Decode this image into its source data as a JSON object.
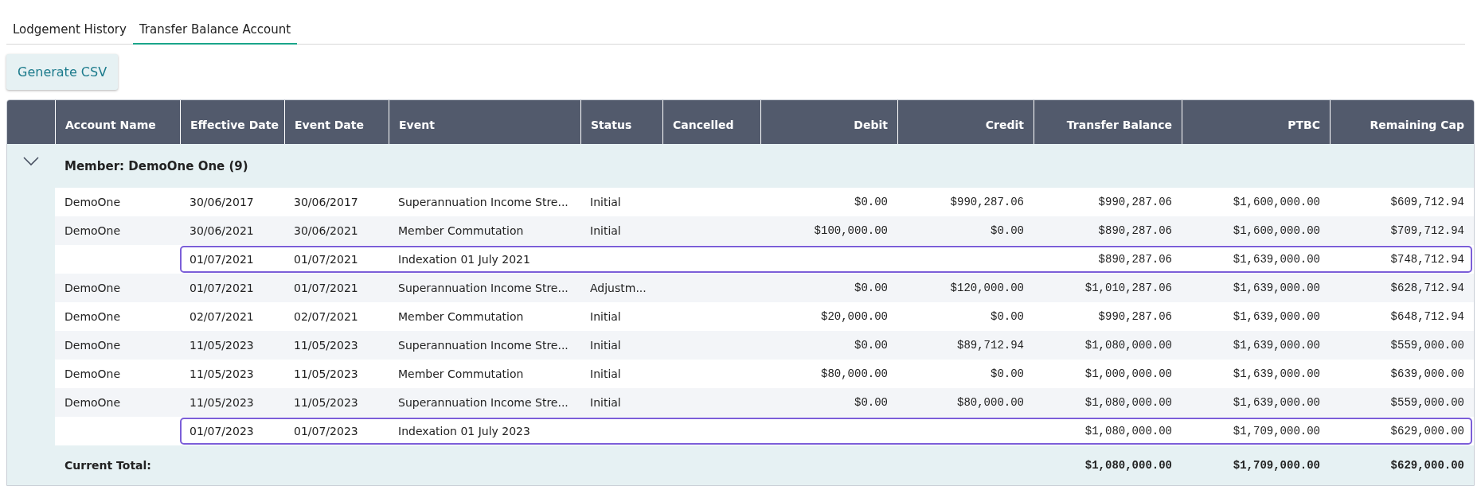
{
  "tabs": [
    {
      "label": "Lodgement History",
      "selected": false
    },
    {
      "label": "Transfer Balance Account",
      "selected": true
    }
  ],
  "toolbar": {
    "button": "Generate CSV"
  },
  "table": {
    "columns": [
      {
        "label": "Account Name",
        "kind": "text"
      },
      {
        "label": "Effective Date",
        "kind": "text"
      },
      {
        "label": "Event Date",
        "kind": "text"
      },
      {
        "label": "Event",
        "kind": "text"
      },
      {
        "label": "Status",
        "kind": "text"
      },
      {
        "label": "Cancelled",
        "kind": "text"
      },
      {
        "label": "Debit",
        "kind": "money"
      },
      {
        "label": "Credit",
        "kind": "money"
      },
      {
        "label": "Transfer Balance",
        "kind": "money"
      },
      {
        "label": "PTBC",
        "kind": "money"
      },
      {
        "label": "Remaining Cap",
        "kind": "money"
      }
    ],
    "groups": [
      {
        "label": "Member: DemoOne One (9)",
        "expanded": true,
        "rows": [
          {
            "highlighted": false,
            "cells": [
              "DemoOne",
              "30/06/2017",
              "30/06/2017",
              "Superannuation Income Stre...",
              "Initial",
              null,
              "$0.00",
              "$990,287.06",
              "$990,287.06",
              "$1,600,000.00",
              "$609,712.94"
            ]
          },
          {
            "highlighted": false,
            "cells": [
              "DemoOne",
              "30/06/2021",
              "30/06/2021",
              "Member Commutation",
              "Initial",
              null,
              "$100,000.00",
              "$0.00",
              "$890,287.06",
              "$1,600,000.00",
              "$709,712.94"
            ]
          },
          {
            "highlighted": true,
            "cells": [
              null,
              "01/07/2021",
              "01/07/2021",
              "Indexation 01 July 2021",
              null,
              null,
              null,
              null,
              "$890,287.06",
              "$1,639,000.00",
              "$748,712.94"
            ]
          },
          {
            "highlighted": false,
            "cells": [
              "DemoOne",
              "01/07/2021",
              "01/07/2021",
              "Superannuation Income Stre...",
              "Adjustm...",
              null,
              "$0.00",
              "$120,000.00",
              "$1,010,287.06",
              "$1,639,000.00",
              "$628,712.94"
            ]
          },
          {
            "highlighted": false,
            "cells": [
              "DemoOne",
              "02/07/2021",
              "02/07/2021",
              "Member Commutation",
              "Initial",
              null,
              "$20,000.00",
              "$0.00",
              "$990,287.06",
              "$1,639,000.00",
              "$648,712.94"
            ]
          },
          {
            "highlighted": false,
            "cells": [
              "DemoOne",
              "11/05/2023",
              "11/05/2023",
              "Superannuation Income Stre...",
              "Initial",
              null,
              "$0.00",
              "$89,712.94",
              "$1,080,000.00",
              "$1,639,000.00",
              "$559,000.00"
            ]
          },
          {
            "highlighted": false,
            "cells": [
              "DemoOne",
              "11/05/2023",
              "11/05/2023",
              "Member Commutation",
              "Initial",
              null,
              "$80,000.00",
              "$0.00",
              "$1,000,000.00",
              "$1,639,000.00",
              "$639,000.00"
            ]
          },
          {
            "highlighted": false,
            "cells": [
              "DemoOne",
              "11/05/2023",
              "11/05/2023",
              "Superannuation Income Stre...",
              "Initial",
              null,
              "$0.00",
              "$80,000.00",
              "$1,080,000.00",
              "$1,639,000.00",
              "$559,000.00"
            ]
          },
          {
            "highlighted": true,
            "cells": [
              null,
              "01/07/2023",
              "01/07/2023",
              "Indexation 01 July 2023",
              null,
              null,
              null,
              null,
              "$1,080,000.00",
              "$1,709,000.00",
              "$629,000.00"
            ]
          }
        ],
        "total": {
          "cells": [
            "Current Total:",
            null,
            null,
            null,
            null,
            null,
            null,
            null,
            "$1,080,000.00",
            "$1,709,000.00",
            "$629,000.00"
          ]
        }
      }
    ]
  }
}
